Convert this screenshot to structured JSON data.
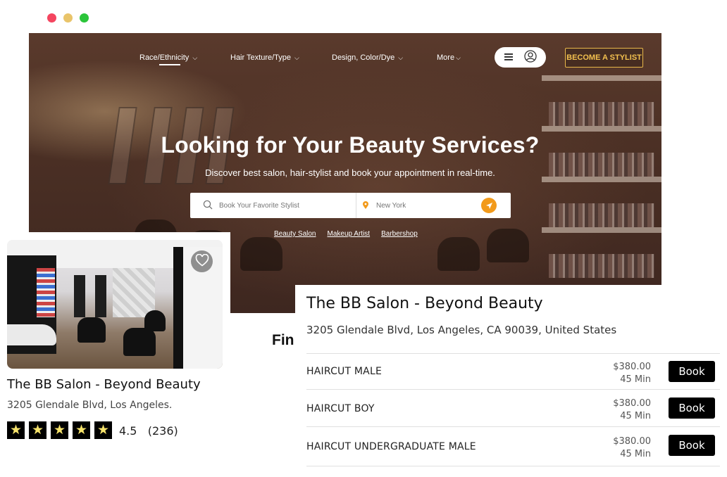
{
  "nav": {
    "items": [
      {
        "label": "Race/Ethnicity"
      },
      {
        "label": "Hair Texture/Type"
      },
      {
        "label": "Design, Color/Dye"
      },
      {
        "label": "More"
      }
    ],
    "cta": "BECOME A STYLIST",
    "menu_icon": "hamburger-menu-icon",
    "user_icon": "user-avatar-icon"
  },
  "hero": {
    "title": "Looking for Your Beauty Services?",
    "subtitle": "Discover best salon, hair-stylist and book your appointment in real-time.",
    "search_placeholder": "Book Your Favorite Stylist",
    "location_placeholder": "New York",
    "quick_links": [
      "Beauty Salon",
      "Makeup Artist",
      "Barbershop"
    ]
  },
  "section_partial_heading": "Fin",
  "salon_card": {
    "name": "The BB Salon - Beyond Beauty",
    "address": "3205 Glendale Blvd, Los Angeles.",
    "stars": 5,
    "rating": "4.5",
    "reviews": "(236)"
  },
  "salon_detail": {
    "name": "The BB Salon - Beyond Beauty",
    "address": "3205 Glendale Blvd, Los Angeles, CA 90039, United States",
    "services": [
      {
        "name": "HAIRCUT MALE",
        "price": "$380.00",
        "duration": "45 Min",
        "action": "Book"
      },
      {
        "name": "HAIRCUT BOY",
        "price": "$380.00",
        "duration": "45 Min",
        "action": "Book"
      },
      {
        "name": "HAIRCUT UNDERGRADUATE MALE",
        "price": "$380.00",
        "duration": "45 Min",
        "action": "Book"
      }
    ]
  },
  "colors": {
    "accent": "#f29a1b",
    "cta_gold": "#f3c14f",
    "star": "#f6e36b",
    "book_button": "#000000"
  }
}
